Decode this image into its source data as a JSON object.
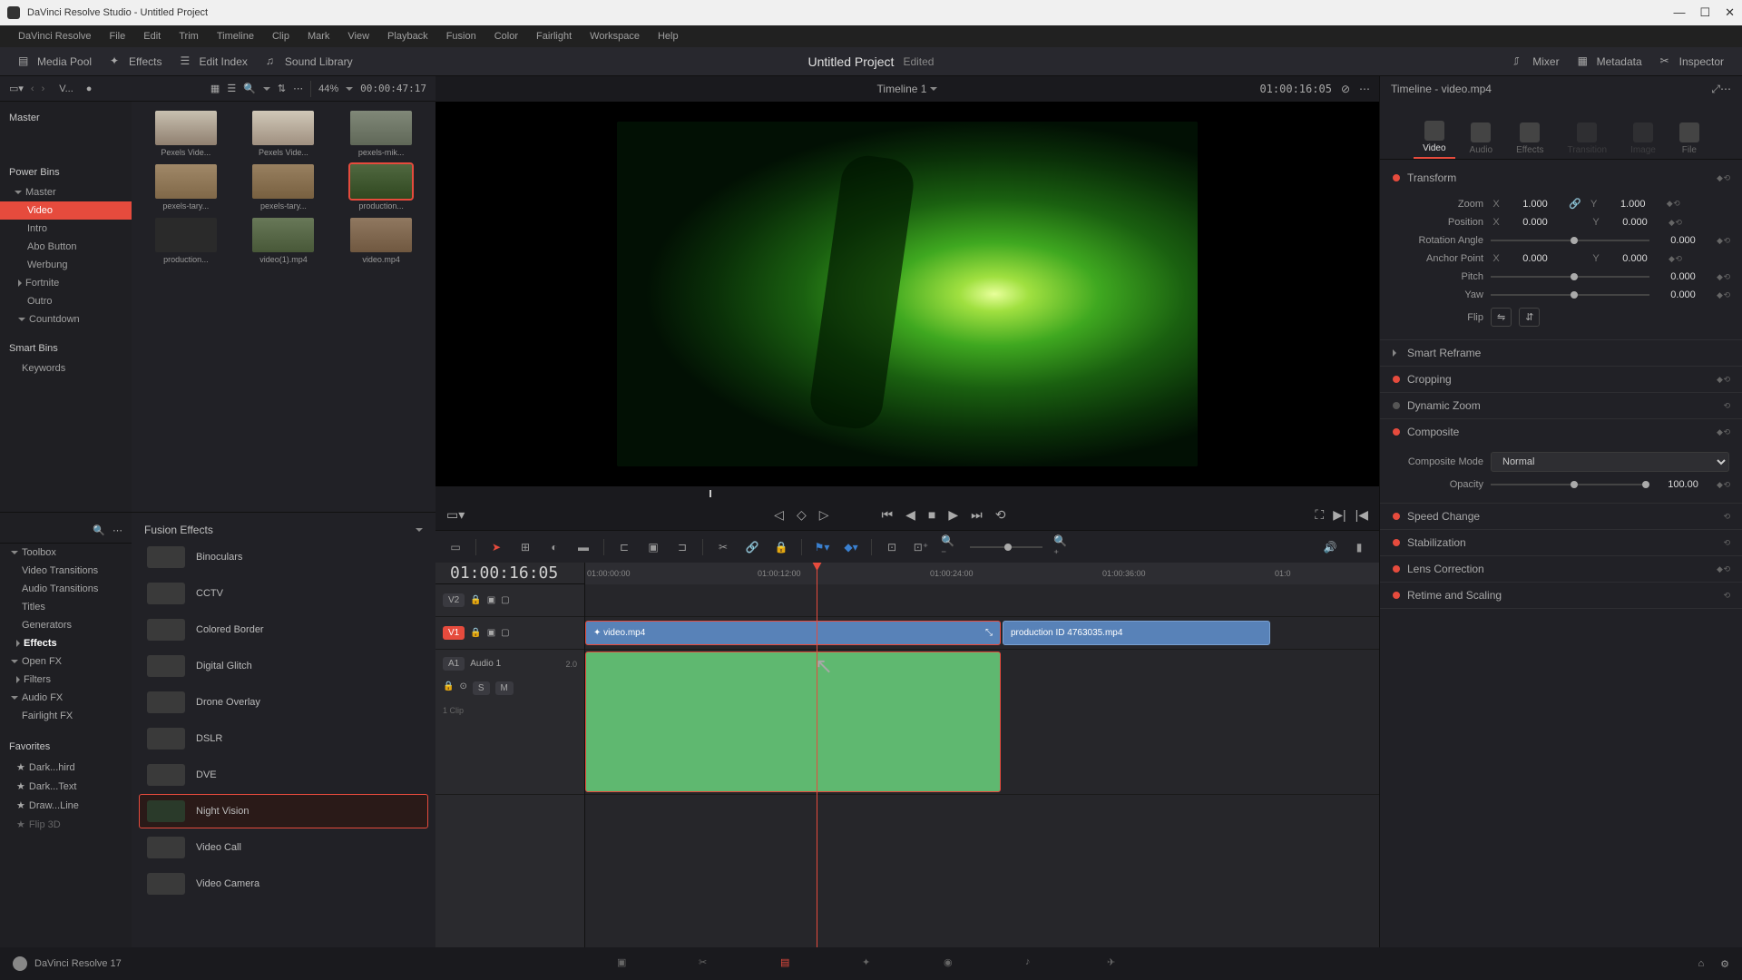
{
  "app": {
    "title": "DaVinci Resolve Studio - Untitled Project",
    "version": "DaVinci Resolve 17"
  },
  "menu": [
    "DaVinci Resolve",
    "File",
    "Edit",
    "Trim",
    "Timeline",
    "Clip",
    "Mark",
    "View",
    "Playback",
    "Fusion",
    "Color",
    "Fairlight",
    "Workspace",
    "Help"
  ],
  "topbar": {
    "media_pool": "Media Pool",
    "effects": "Effects",
    "edit_index": "Edit Index",
    "sound_library": "Sound Library",
    "mixer": "Mixer",
    "metadata": "Metadata",
    "inspector": "Inspector",
    "project": "Untitled Project",
    "status": "Edited"
  },
  "media_hdr": {
    "sort": "V...",
    "zoom": "44%",
    "tc": "00:00:47:17"
  },
  "bins": {
    "master": "Master",
    "power": "Power Bins",
    "items": [
      "Master",
      "Video",
      "Intro",
      "Abo Button",
      "Werbung",
      "Fortnite",
      "Outro",
      "Countdown"
    ],
    "smart": "Smart Bins",
    "keywords": "Keywords"
  },
  "thumbs": [
    {
      "label": "Pexels Vide..."
    },
    {
      "label": "Pexels Vide..."
    },
    {
      "label": "pexels-mik..."
    },
    {
      "label": "pexels-tary..."
    },
    {
      "label": "pexels-tary..."
    },
    {
      "label": "production..."
    },
    {
      "label": "production..."
    },
    {
      "label": "video(1).mp4"
    },
    {
      "label": "video.mp4"
    }
  ],
  "fx_tree": [
    {
      "label": "Toolbox",
      "exp": true
    },
    {
      "label": "Video Transitions",
      "indent": 1
    },
    {
      "label": "Audio Transitions",
      "indent": 1
    },
    {
      "label": "Titles",
      "indent": 1
    },
    {
      "label": "Generators",
      "indent": 1
    },
    {
      "label": "Effects",
      "indent": 1,
      "sel": true
    },
    {
      "label": "Open FX",
      "exp": true
    },
    {
      "label": "Filters",
      "indent": 1
    },
    {
      "label": "Audio FX",
      "exp": true
    },
    {
      "label": "Fairlight FX",
      "indent": 1
    }
  ],
  "fx_favorites": "Favorites",
  "fx_fav_items": [
    "Dark...hird",
    "Dark...Text",
    "Draw...Line",
    "Flip 3D"
  ],
  "fx_header": "Fusion Effects",
  "fx_items": [
    {
      "name": "Binoculars"
    },
    {
      "name": "CCTV"
    },
    {
      "name": "Colored Border"
    },
    {
      "name": "Digital Glitch"
    },
    {
      "name": "Drone Overlay"
    },
    {
      "name": "DSLR"
    },
    {
      "name": "DVE"
    },
    {
      "name": "Night Vision",
      "sel": true
    },
    {
      "name": "Video Call"
    },
    {
      "name": "Video Camera"
    }
  ],
  "viewer": {
    "title": "Timeline 1",
    "tc_right": "01:00:16:05"
  },
  "timeline": {
    "tc": "01:00:16:05",
    "ruler": [
      "01:00:00:00",
      "01:00:12:00",
      "01:00:24:00",
      "01:00:36:00",
      "01:0"
    ],
    "tracks": {
      "v2": "V2",
      "v1": "V1",
      "a1": "A1",
      "a1_name": "Audio 1",
      "a1_ch": "2.0",
      "a1_clips": "1 Clip"
    },
    "clips": {
      "c1": "video.mp4",
      "c2": "production ID 4763035.mp4"
    }
  },
  "inspector": {
    "title": "Timeline - video.mp4",
    "tabs": [
      "Video",
      "Audio",
      "Effects",
      "Transition",
      "Image",
      "File"
    ],
    "transform": {
      "title": "Transform",
      "zoom": "Zoom",
      "zoom_x": "1.000",
      "zoom_y": "1.000",
      "position": "Position",
      "pos_x": "0.000",
      "pos_y": "0.000",
      "rotation": "Rotation Angle",
      "rot_v": "0.000",
      "anchor": "Anchor Point",
      "anc_x": "0.000",
      "anc_y": "0.000",
      "pitch": "Pitch",
      "pitch_v": "0.000",
      "yaw": "Yaw",
      "yaw_v": "0.000",
      "flip": "Flip"
    },
    "sections": {
      "smart_reframe": "Smart Reframe",
      "cropping": "Cropping",
      "dynamic_zoom": "Dynamic Zoom",
      "composite": "Composite",
      "composite_mode": "Composite Mode",
      "composite_mode_v": "Normal",
      "opacity": "Opacity",
      "opacity_v": "100.00",
      "speed": "Speed Change",
      "stab": "Stabilization",
      "lens": "Lens Correction",
      "retime": "Retime and Scaling"
    }
  }
}
